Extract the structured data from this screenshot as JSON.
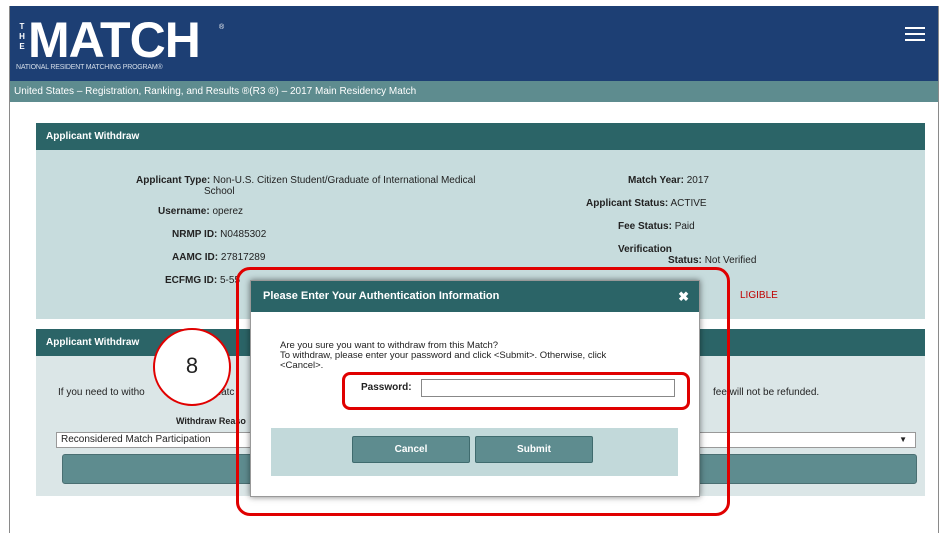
{
  "header": {
    "logo_the": [
      "T",
      "H",
      "E"
    ],
    "logo_text": "MATCH",
    "logo_reg": "®",
    "logo_subtitle": "NATIONAL RESIDENT MATCHING PROGRAM®",
    "menu_icon": "hamburger-icon"
  },
  "subbar": {
    "text": "United States  –  Registration, Ranking, and Results ®(R3 ®)  –  2017 Main Residency Match"
  },
  "applicant_panel": {
    "title": "Applicant Withdraw",
    "applicant_type_label": "Applicant Type:",
    "applicant_type_value": "Non-U.S. Citizen Student/Graduate of International Medical",
    "applicant_type_value2": "School",
    "username_label": "Username:",
    "username_value": "operez",
    "nrmp_label": "NRMP ID:",
    "nrmp_value": "N0485302",
    "aamc_label": "AAMC ID:",
    "aamc_value": "27817289",
    "ecfmg_label": "ECFMG ID:",
    "ecfmg_value": "5-55",
    "match_year_label": "Match Year:",
    "match_year_value": "2017",
    "status_label": "Applicant Status:",
    "status_value": "ACTIVE",
    "fee_label": "Fee Status:",
    "fee_value": "Paid",
    "verification_label": "Verification",
    "verification_status_label": "Status:",
    "verification_value": "Not Verified",
    "eligibility_value": "LIGIBLE"
  },
  "withdraw_panel": {
    "title": "Applicant Withdraw",
    "text_left": "If you need to witho",
    "text_mid": "Matc",
    "text_right": "fee will not be refunded.",
    "reason_label": "Withdraw Reaso",
    "reason_selected": "Reconsidered Match Participation"
  },
  "modal": {
    "title": "Please Enter Your Authentication Information",
    "close_icon": "close-icon",
    "close_glyph": "✖",
    "message_line1": "Are you sure you want to withdraw from this Match?",
    "message_line2": "To withdraw, please enter your password and click <Submit>. Otherwise, click",
    "message_line3": "<Cancel>.",
    "password_label": "Password:",
    "password_value": "",
    "cancel_label": "Cancel",
    "submit_label": "Submit"
  },
  "callout": {
    "number": "8"
  },
  "colors": {
    "header_bg": "#1d3f74",
    "teal_dark": "#2b6467",
    "teal_mid": "#5e8c8f",
    "panel_bg": "#c7dcdd",
    "annotation_red": "#e00000"
  }
}
